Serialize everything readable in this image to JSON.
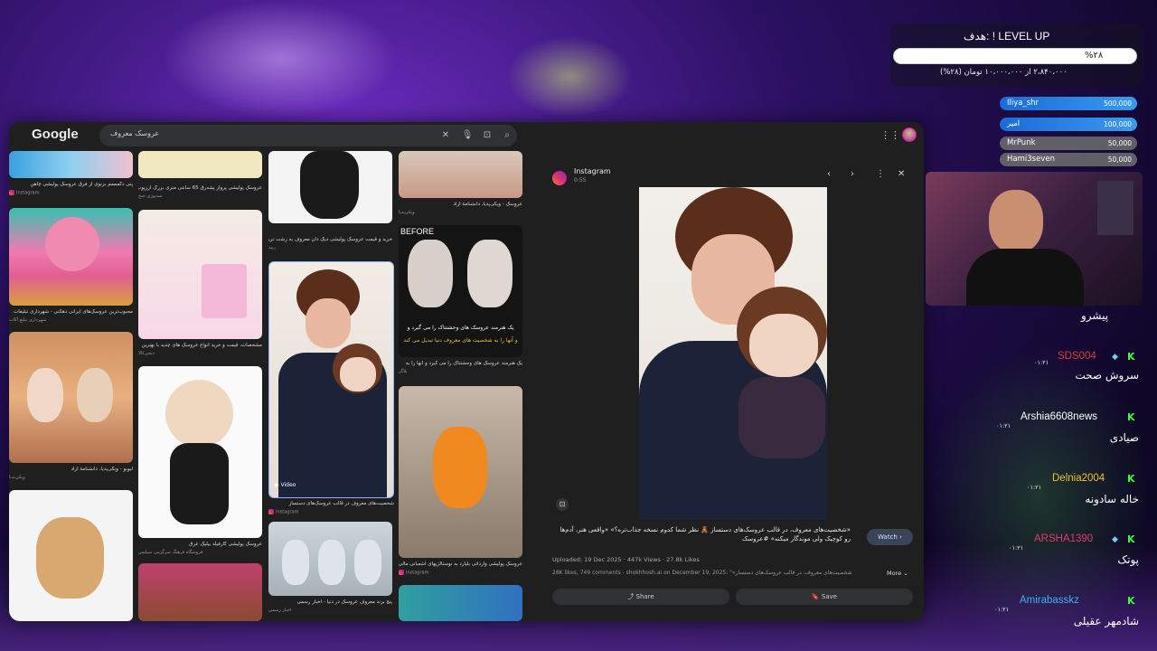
{
  "browser": {
    "logo": "Google",
    "search_query": "عروسک معروف",
    "grid": {
      "items": [
        {
          "caption": "پنی دگمممم برنوی از فرق عروسک پولیشی چاهن",
          "source": "Instagram"
        },
        {
          "caption": "عروسک پولیشی پرواز پشه‌رق 65 سانتی متری بزرگ ارزپوب",
          "source": "مندیوژی جنخ"
        },
        {
          "caption": "خرید و قیمت عروسک پولیشی دیگ دان معروف به زشت ترین",
          "source": "ربید"
        },
        {
          "caption": "عروسک - ویکی‌پدیا، دانشنامهٔ آزاد",
          "source": "ویکی‌پدیا"
        },
        {
          "caption": "محبوب‌ترین عروسک‌های ایرانی دهکنی - شهرداری تبلیغات",
          "source": "شهرداری تبلیغ آکات"
        },
        {
          "caption": "مشخصات، قیمت و خرید انواع عروسک های چدید با بهترین",
          "source": "دیجی‌کالا"
        },
        {
          "caption": "شخصیت‌های معروف در قالب عروسک‌های دستساز",
          "source": "Instagram"
        },
        {
          "caption": "یک هنرمند عروسک های وحشتناک را می گیرد و آنها را به",
          "source": "بلاگر"
        },
        {
          "caption": "لبوبو - ویکی‌پدیا، دانشنامهٔ آزاد",
          "source": "ویکی‌پدیا"
        },
        {
          "caption": "عروسک پولیشی گارفیلد بیلیک عرق",
          "source": "فروشگاه فرهنگ سرگرمی سیلیس"
        },
        {
          "caption": "پنج برند معروف عروسک در دنیا - اخبار رسمی",
          "source": "اخبار رسمی"
        },
        {
          "caption": "عروسک پولیشی وارداتی بلیارد به نوستالژیهای اشعبانی مالی",
          "source": "Instagram"
        }
      ],
      "video_label": "Video",
      "before_label": "BEFORE",
      "meme_text_1": "یک هنرمند عروسک های وحشتناک را می گیرد و",
      "meme_text_2": "و آنها را به شخصیت های معروف دنیا تبدیل می کند"
    },
    "panel": {
      "source": "Instagram",
      "time": "0:55",
      "description": "«شخصیت‌های معروف، در قالب عروسک‌های دستساز 🧸 نظر شما کدوم نسخه جذاب‌تره؟» «واقعی هنر، آدم‌ها رو کوچیک ولی موندگار میکنه» #عروسک",
      "watch_label": "Watch",
      "uploaded": "Uploaded: 19 Dec 2025",
      "views": "447k Views",
      "likes": "27.8k Likes",
      "comment": "28K likes, 749 comments - shokhhosh.ai on December 19, 2025: \"«شخصیت‌های معروف، در قالب عروسک‌های دستساز",
      "more_label": "More",
      "share_label": "Share",
      "save_label": "Save"
    }
  },
  "overlay": {
    "goal_title": "هدف: ! LEVEL UP",
    "goal_percent": "%۲۸",
    "goal_progress_fraction": 0.28,
    "goal_sub": "۲،۸۴۰،۰۰۰ از ۱۰،۰۰۰،۰۰۰ تومان (۲۸%)",
    "donors": [
      {
        "name": "Iliya_shr",
        "amount": "500,000",
        "color": "#2f7de0"
      },
      {
        "name": "امیر",
        "amount": "100,000",
        "color": "#2f7de0"
      },
      {
        "name": "MrPunk",
        "amount": "50,000",
        "color": "#6b6b6b"
      },
      {
        "name": "Hami3seven",
        "amount": "50,000",
        "color": "#6b6b6b"
      }
    ]
  },
  "chat": {
    "title": "پیشرو",
    "messages": [
      {
        "time": "۰۱:۲۱",
        "user": "SDS004",
        "user_color": "#e03a3a",
        "text": "سروش صحت",
        "diamond": true
      },
      {
        "time": "۰۱:۲۱",
        "user": "Arshia6608news",
        "user_color": "#ffffff",
        "text": "صیادی",
        "diamond": false
      },
      {
        "time": "۰۱:۲۱",
        "user": "Delnia2004",
        "user_color": "#f0c030",
        "text": "خاله سادونه",
        "diamond": false
      },
      {
        "time": "۰۱:۲۱",
        "user": "ARSHA1390",
        "user_color": "#e03a6a",
        "text": "پوتک",
        "diamond": true
      },
      {
        "time": "۰۱:۲۱",
        "user": "Amirabasskz",
        "user_color": "#40b0f0",
        "text": "شادمهر عقیلی",
        "diamond": false
      }
    ]
  }
}
